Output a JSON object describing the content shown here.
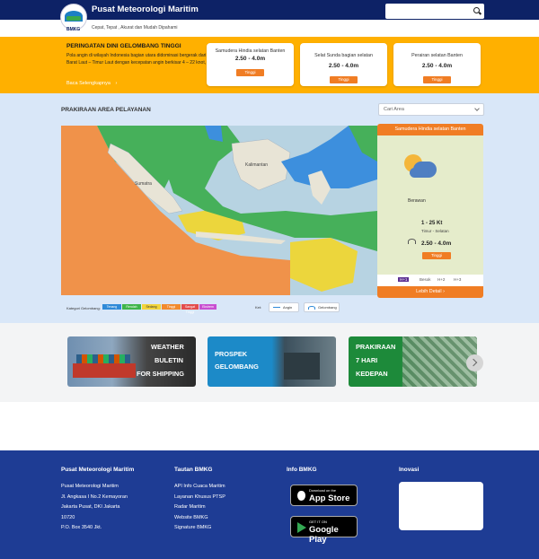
{
  "header": {
    "title": "Pusat Meteorologi Maritim",
    "tagline": "Cepat, Tepat , Akurat dan Mudah Dipahami",
    "logo_text": "BMKG",
    "search": {
      "placeholder": ""
    }
  },
  "warning": {
    "title": "PERINGATAN DINI GELOMBANG TINGGI",
    "body": "Pola angin di wilayah Indonesia bagian utara didominasi bergerak dari Barat Laut – Timur Laut dengan kecepatan angin berkisar 4 – 22 knot,",
    "read_more": "Baca Selengkapnya",
    "cards": [
      {
        "name": "Samudera Hindia selatan Banten",
        "value": "2.50 - 4.0m",
        "badge": "Tinggi"
      },
      {
        "name": "Selat Sunda bagian selatan",
        "value": "2.50 - 4.0m",
        "badge": "Tinggi"
      },
      {
        "name": "Perairan selatan Banten",
        "value": "2.50 - 4.0m",
        "badge": "Tinggi"
      }
    ]
  },
  "forecast": {
    "title": "PRAKIRAAN AREA PELAYANAN",
    "area_select": "Cari Area",
    "map_labels": [
      "Sumatra",
      "Kalimantan"
    ],
    "panel": {
      "title": "Samudera Hindia selatan Banten",
      "sky": "Berawan",
      "wind": "1 - 25 Kt",
      "wind_dir": "Timur - Selatan",
      "wave": "2.50 - 4.0m",
      "badge": "Tinggi",
      "days": [
        "H+1",
        "Besok",
        "H+2",
        "H+3"
      ],
      "detail": "Lebih Detail"
    },
    "legend": {
      "label": "Kategori Gelombang:",
      "items": [
        "Tenang",
        "Rendah",
        "Sedang",
        "Tinggi",
        "Sangat Tinggi",
        "Ekstrem"
      ],
      "colors": [
        "#2f8ad8",
        "#3fb54a",
        "#f2d43b",
        "#f28a2e",
        "#e34c4c",
        "#c84fd1"
      ]
    },
    "layers_label": "Ket:",
    "layer_buttons": [
      "Angin",
      "Gelombang"
    ]
  },
  "banners": [
    {
      "title_lines": [
        "WEATHER",
        "BULETIN",
        "FOR SHIPPING"
      ],
      "icon": "cargo-ship-photo"
    },
    {
      "title_lines": [
        "PROSPEK",
        "GELOMBANG"
      ],
      "icon": "ship-bridge-photo"
    },
    {
      "title_lines": [
        "PRAKIRAAN",
        "7 HARI",
        "KEDEPAN"
      ],
      "icon": "calendar-photo"
    }
  ],
  "footer": {
    "col1": {
      "title": "Pusat Meteorologi Maritim",
      "lines": [
        "Pusat Meteorologi Maritim",
        "Jl. Angkasa I No.2 Kemayoran",
        "Jakarta Pusat, DKI Jakarta",
        "10720",
        "P.O. Box 3540 Jkt."
      ]
    },
    "col2": {
      "title": "Tautan BMKG",
      "links": [
        "API Info Cuaca Maritim",
        "Layanan Khusus PTSP",
        "Radar Maritim",
        "Website BMKG",
        "Signature BMKG"
      ]
    },
    "col3": {
      "title": "Info BMKG",
      "app_store_small": "Download on the",
      "app_store": "App Store",
      "play_small": "GET IT ON",
      "play": "Google Play"
    },
    "col4": {
      "title": "Inovasi"
    }
  }
}
